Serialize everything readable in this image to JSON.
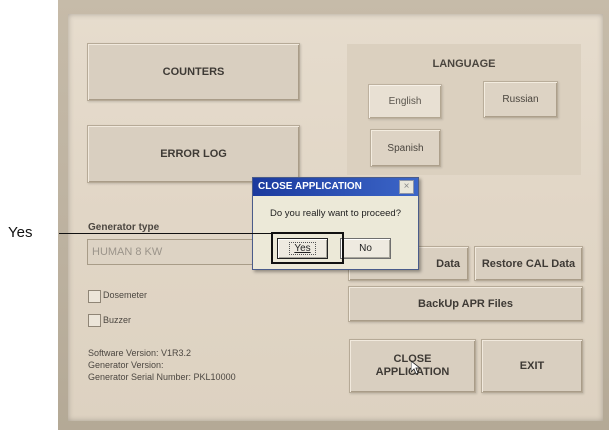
{
  "annotation": {
    "label": "Yes"
  },
  "buttons": {
    "counters": "COUNTERS",
    "error_log": "ERROR LOG",
    "restore_data": "Data",
    "restore_cal_data": "Restore CAL Data",
    "backup_apr": "BackUp APR Files",
    "close_application": "CLOSE\nAPPLICATION",
    "exit": "EXIT"
  },
  "language": {
    "title": "LANGUAGE",
    "options": [
      "English",
      "Russian",
      "Spanish"
    ]
  },
  "generator": {
    "label": "Generator type",
    "value": "HUMAN 8 KW"
  },
  "checkboxes": [
    "Dosemeter",
    "Buzzer"
  ],
  "info": {
    "software_version": "Software Version: V1R3.2",
    "generator_version": "Generator Version:",
    "serial_number": "Generator Serial Number: PKL10000"
  },
  "dialog": {
    "title": "CLOSE APPLICATION",
    "close_glyph": "×",
    "message": "Do you really want to proceed?",
    "yes_label": "Yes",
    "no_label": "No"
  },
  "colors": {
    "screen_bg": "#e3d9c9",
    "dialog_title_bar": "#2a4fb3",
    "annotation": "#111111"
  }
}
